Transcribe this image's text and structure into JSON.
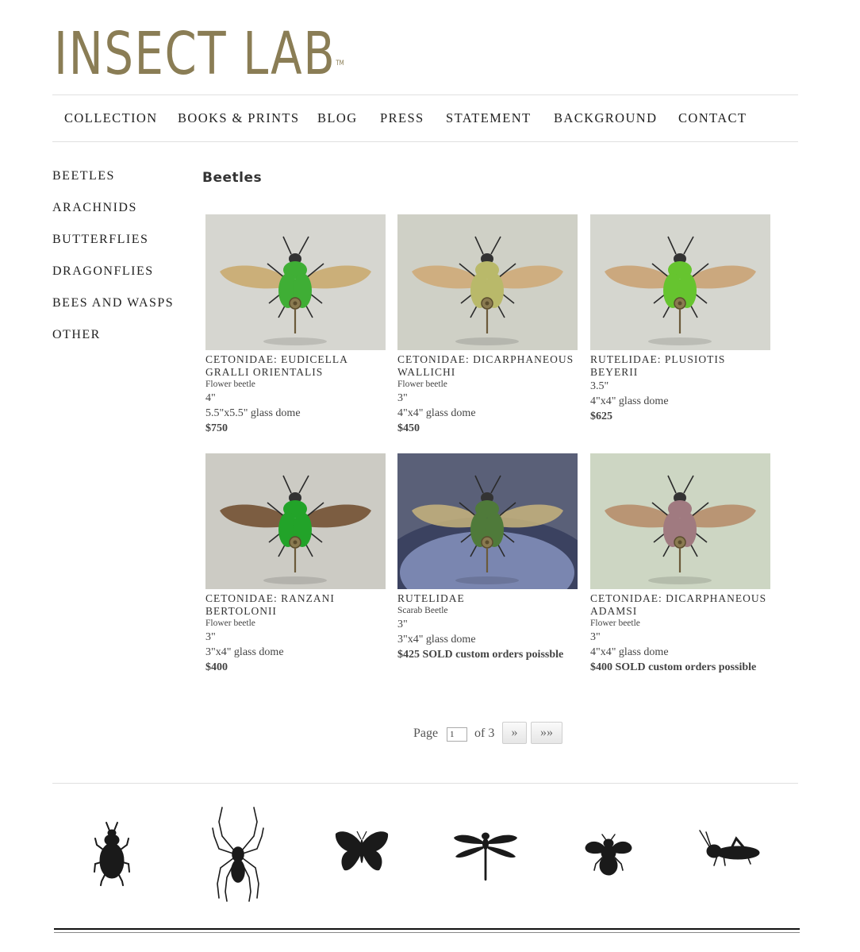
{
  "brand": {
    "logo_text": "INSECT LAB",
    "tm": "TM",
    "color": "#8a7d55"
  },
  "top_nav": [
    "COLLECTION",
    "BOOKS & PRINTS",
    "BLOG",
    "PRESS",
    "STATEMENT",
    "BACKGROUND",
    "CONTACT"
  ],
  "side_nav": [
    "BEETLES",
    "ARACHNIDS",
    "BUTTERFLIES",
    "DRAGONFLIES",
    "BEES AND WASPS",
    "OTHER"
  ],
  "page": {
    "title": "Beetles"
  },
  "products": [
    {
      "title": "CETONIDAE: EUDICELLA GRALLI ORIENTALIS",
      "common": "Flower beetle",
      "size": "4\"",
      "dome": "5.5\"x5.5\" glass dome",
      "price": "$750",
      "colors": {
        "bg": "#d6d6d0",
        "body": "#3fae35",
        "wing": "#c9a86a"
      }
    },
    {
      "title": "CETONIDAE: DICARPHANEOUS WALLICHI",
      "common": "Flower beetle",
      "size": "3\"",
      "dome": "4\"x4\" glass dome",
      "price": "$450",
      "colors": {
        "bg": "#cfd0c6",
        "body": "#b9b96a",
        "wing": "#cfa873"
      }
    },
    {
      "title": "RUTELIDAE: PLUSIOTIS BEYERII",
      "common": "",
      "size": "3.5\"",
      "dome": "4\"x4\" glass dome",
      "price": "$625",
      "colors": {
        "bg": "#d5d6cf",
        "body": "#66c42f",
        "wing": "#c9a070"
      }
    },
    {
      "title": "CETONIDAE: RANZANI BERTOLONII",
      "common": "Flower beetle",
      "size": "3\"",
      "dome": "3\"x4\" glass dome",
      "price": "$400",
      "colors": {
        "bg": "#cccbc4",
        "body": "#22a329",
        "wing": "#6d4a2a"
      }
    },
    {
      "title": "RUTELIDAE",
      "common": "Scarab Beetle",
      "size": "3\"",
      "dome": "3\"x4\" glass dome",
      "price": "$425 SOLD custom orders poissble",
      "colors": {
        "bg": "#5a6078",
        "body": "#4f7a3a",
        "wing": "#c8b47c"
      }
    },
    {
      "title": "CETONIDAE: DICARPHANEOUS ADAMSI",
      "common": "Flower beetle",
      "size": "3\"",
      "dome": "4\"x4\" glass dome",
      "price": "$400 SOLD custom orders possible",
      "colors": {
        "bg": "#cdd6c3",
        "body": "#a07a80",
        "wing": "#b58a66"
      }
    }
  ],
  "pagination": {
    "page_label": "Page",
    "current": "1",
    "of_label": "of 3",
    "next": "»",
    "last": "»»"
  },
  "footer_icons": [
    "beetle-icon",
    "spider-icon",
    "butterfly-icon",
    "dragonfly-icon",
    "bee-icon",
    "grasshopper-icon"
  ]
}
